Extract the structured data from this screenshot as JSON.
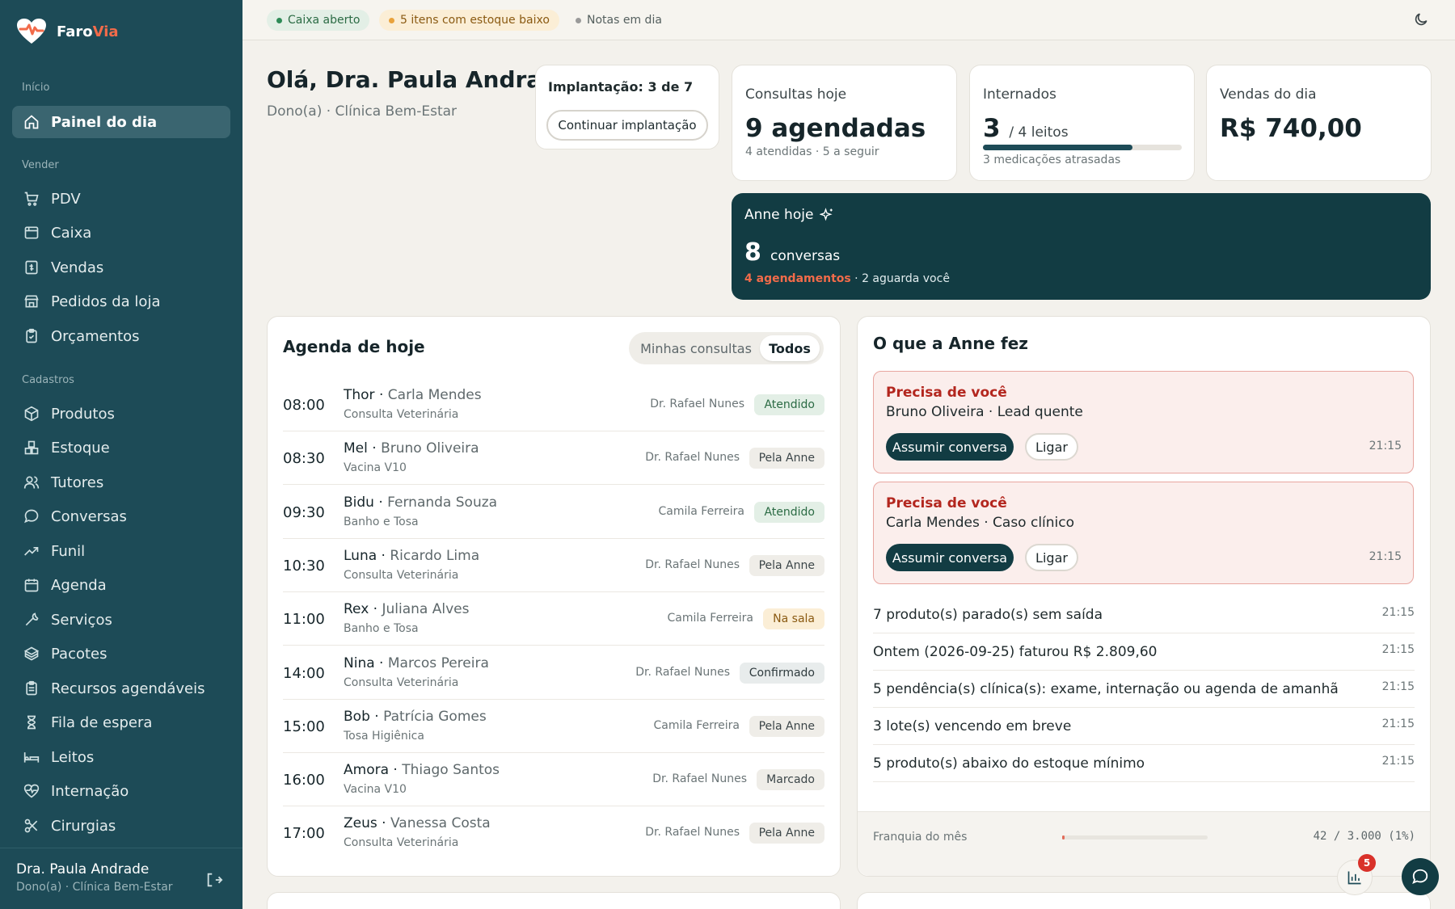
{
  "brand": {
    "name_main": "Faro",
    "name_accent": "Via"
  },
  "sidebar": {
    "sections": [
      {
        "label": "Início",
        "items": [
          {
            "label": "Painel do dia",
            "icon": "home-icon",
            "active": true
          }
        ]
      },
      {
        "label": "Vender",
        "items": [
          {
            "label": "PDV",
            "icon": "cart-icon"
          },
          {
            "label": "Caixa",
            "icon": "cash-register-icon"
          },
          {
            "label": "Vendas",
            "icon": "receipt-icon"
          },
          {
            "label": "Pedidos da loja",
            "icon": "store-icon"
          },
          {
            "label": "Orçamentos",
            "icon": "clipboard-icon"
          }
        ]
      },
      {
        "label": "Cadastros",
        "items": [
          {
            "label": "Produtos",
            "icon": "box-icon"
          },
          {
            "label": "Estoque",
            "icon": "boxes-icon"
          },
          {
            "label": "Tutores",
            "icon": "users-icon"
          },
          {
            "label": "Conversas",
            "icon": "chat-icon"
          },
          {
            "label": "Funil",
            "icon": "trend-icon"
          },
          {
            "label": "Agenda",
            "icon": "calendar-icon"
          },
          {
            "label": "Serviços",
            "icon": "wrench-icon"
          },
          {
            "label": "Pacotes",
            "icon": "package-icon"
          },
          {
            "label": "Recursos agendáveis",
            "icon": "clipboard-list-icon"
          },
          {
            "label": "Fila de espera",
            "icon": "hourglass-icon"
          },
          {
            "label": "Leitos",
            "icon": "bed-icon"
          },
          {
            "label": "Internação",
            "icon": "heart-pulse-icon"
          },
          {
            "label": "Cirurgias",
            "icon": "scissors-icon"
          }
        ]
      }
    ],
    "user": {
      "name": "Dra. Paula Andrade",
      "role": "Dono(a) · Clínica Bem-Estar"
    }
  },
  "topbar": {
    "pills": [
      {
        "label": "Caixa aberto",
        "color": "#2e8b57",
        "bg": "#e3efe6",
        "text": "#2b6b44"
      },
      {
        "label": "5 itens com estoque baixo",
        "color": "#e9a23b",
        "bg": "#fbeed6",
        "text": "#8a5a12"
      },
      {
        "label": "Notas em dia",
        "color": "#9a9a9a",
        "bg": "transparent",
        "text": "#55605f"
      }
    ]
  },
  "header": {
    "greeting": "Olá, Dra. Paula Andrade",
    "subtitle": "Dono(a) · Clínica Bem-Estar"
  },
  "onboarding": {
    "title": "Implantação: 3 de 7",
    "button": "Continuar implantação"
  },
  "stats": {
    "consultas": {
      "label": "Consultas hoje",
      "value": "9 agendadas",
      "sub": "4 atendidas · 5 a seguir"
    },
    "internados": {
      "label": "Internados",
      "value": "3",
      "unit": "/ 4 leitos",
      "occupancy": 0.75,
      "sub": "3 medicações atrasadas"
    },
    "vendas": {
      "label": "Vendas do dia",
      "value": "R$ 740,00"
    }
  },
  "anne_today": {
    "title": "Anne hoje",
    "count": "8",
    "unit": "conversas",
    "highlight": "4 agendamentos",
    "rest": " · 2 aguarda você"
  },
  "agenda": {
    "title": "Agenda de hoje",
    "filters": [
      "Minhas consultas",
      "Todos"
    ],
    "rows": [
      {
        "time": "08:00",
        "pet": "Thor",
        "owner": "Carla Mendes",
        "service": "Consulta Veterinária",
        "doctor": "Dr. Rafael Nunes",
        "status": "Atendido"
      },
      {
        "time": "08:30",
        "pet": "Mel",
        "owner": "Bruno Oliveira",
        "service": "Vacina V10",
        "doctor": "Dr. Rafael Nunes",
        "status": "Pela Anne"
      },
      {
        "time": "09:30",
        "pet": "Bidu",
        "owner": "Fernanda Souza",
        "service": "Banho e Tosa",
        "doctor": "Camila Ferreira",
        "status": "Atendido"
      },
      {
        "time": "10:30",
        "pet": "Luna",
        "owner": "Ricardo Lima",
        "service": "Consulta Veterinária",
        "doctor": "Dr. Rafael Nunes",
        "status": "Pela Anne"
      },
      {
        "time": "11:00",
        "pet": "Rex",
        "owner": "Juliana Alves",
        "service": "Banho e Tosa",
        "doctor": "Camila Ferreira",
        "status": "Na sala"
      },
      {
        "time": "14:00",
        "pet": "Nina",
        "owner": "Marcos Pereira",
        "service": "Consulta Veterinária",
        "doctor": "Dr. Rafael Nunes",
        "status": "Confirmado"
      },
      {
        "time": "15:00",
        "pet": "Bob",
        "owner": "Patrícia Gomes",
        "service": "Tosa Higiênica",
        "doctor": "Camila Ferreira",
        "status": "Pela Anne"
      },
      {
        "time": "16:00",
        "pet": "Amora",
        "owner": "Thiago Santos",
        "service": "Vacina V10",
        "doctor": "Dr. Rafael Nunes",
        "status": "Marcado"
      },
      {
        "time": "17:00",
        "pet": "Zeus",
        "owner": "Vanessa Costa",
        "service": "Consulta Veterinária",
        "doctor": "Dr. Rafael Nunes",
        "status": "Pela Anne"
      }
    ],
    "status_colors": {
      "Atendido": {
        "bg": "#e3efe6",
        "fg": "#2b6b44"
      },
      "Pela Anne": {
        "bg": "#efede8",
        "fg": "#3c4649"
      },
      "Na sala": {
        "bg": "#fbeed6",
        "fg": "#8a5a12"
      },
      "Confirmado": {
        "bg": "#e8ecec",
        "fg": "#2f3b3e"
      },
      "Marcado": {
        "bg": "#efede8",
        "fg": "#3c4649"
      }
    }
  },
  "anne_feed": {
    "title": "O que a Anne fez",
    "alerts": [
      {
        "title": "Precisa de você",
        "desc": "Bruno Oliveira · Lead quente",
        "primary": "Assumir conversa",
        "secondary": "Ligar",
        "time": "21:15"
      },
      {
        "title": "Precisa de você",
        "desc": "Carla Mendes · Caso clínico",
        "primary": "Assumir conversa",
        "secondary": "Ligar",
        "time": "21:15"
      }
    ],
    "items": [
      {
        "text": "7 produto(s) parado(s) sem saída",
        "time": "21:15"
      },
      {
        "text": "Ontem (2026-09-25) faturou R$ 2.809,60",
        "time": "21:15"
      },
      {
        "text": "5 pendência(s) clínica(s): exame, internação ou agenda de amanhã",
        "time": "21:15"
      },
      {
        "text": "3 lote(s) vencendo em breve",
        "time": "21:15"
      },
      {
        "text": "5 produto(s) abaixo do estoque mínimo",
        "time": "21:15"
      }
    ],
    "franchise": {
      "label": "Franquia do mês",
      "value": "42 / 3.000 (1%)",
      "fraction": 0.014
    }
  },
  "fab": {
    "notifications": "5"
  }
}
